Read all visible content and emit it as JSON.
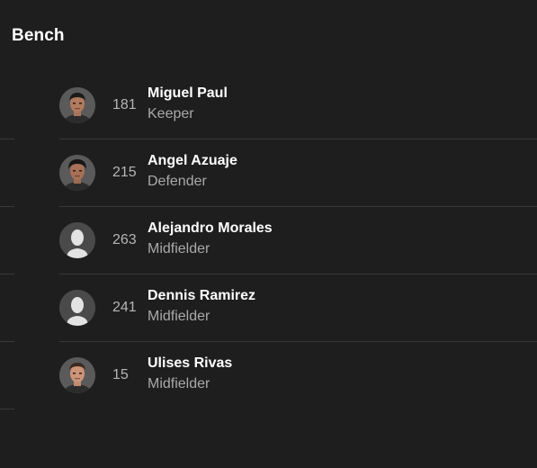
{
  "section": {
    "title": "Bench"
  },
  "players": [
    {
      "number": "181",
      "name": "Miguel Paul",
      "position": "Keeper",
      "avatar": "player-photo-icon"
    },
    {
      "number": "215",
      "name": "Angel Azuaje",
      "position": "Defender",
      "avatar": "player-photo-icon"
    },
    {
      "number": "263",
      "name": "Alejandro Morales",
      "position": "Midfielder",
      "avatar": "silhouette-icon"
    },
    {
      "number": "241",
      "name": "Dennis Ramirez",
      "position": "Midfielder",
      "avatar": "silhouette-icon"
    },
    {
      "number": "15",
      "name": "Ulises Rivas",
      "position": "Midfielder",
      "avatar": "player-photo-icon"
    }
  ],
  "colors": {
    "background": "#1e1e1e",
    "divider": "#383838",
    "primary_text": "#ffffff",
    "secondary_text": "#a9a9a9"
  }
}
